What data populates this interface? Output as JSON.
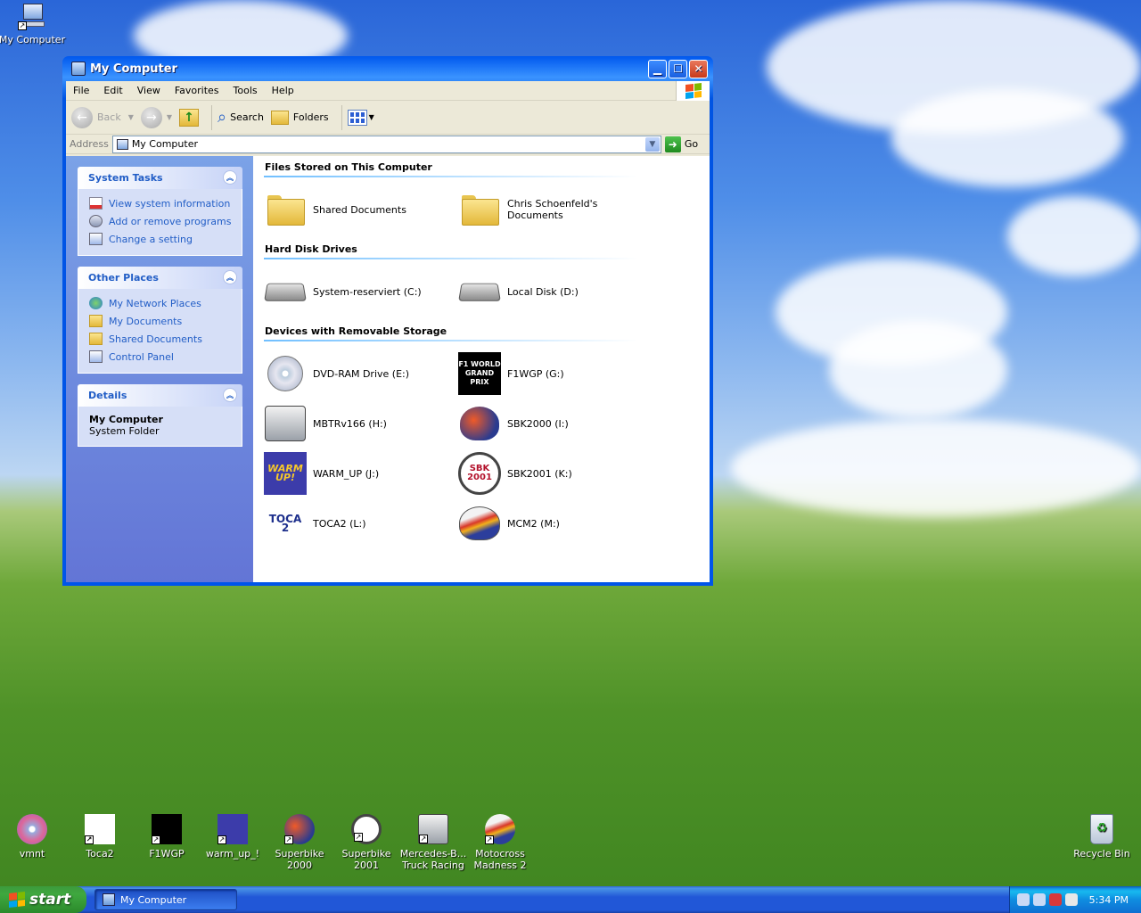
{
  "desktop": {
    "top_icons": [
      {
        "label": "My Computer"
      }
    ],
    "bottom_icons": [
      {
        "label": "vmnt"
      },
      {
        "label": "Toca2"
      },
      {
        "label": "F1WGP"
      },
      {
        "label": "warm_up_!"
      },
      {
        "label": "Superbike 2000"
      },
      {
        "label": "Superbike 2001"
      },
      {
        "label": "Mercedes-B... Truck Racing"
      },
      {
        "label": "Motocross Madness 2"
      }
    ],
    "recycle_bin": {
      "label": "Recycle Bin"
    }
  },
  "window": {
    "title": "My Computer",
    "menu": [
      "File",
      "Edit",
      "View",
      "Favorites",
      "Tools",
      "Help"
    ],
    "toolbar": {
      "back": "Back",
      "search": "Search",
      "folders": "Folders"
    },
    "address": {
      "label": "Address",
      "value": "My Computer",
      "go": "Go"
    },
    "tasks": {
      "system_tasks": {
        "title": "System Tasks",
        "links": [
          "View system information",
          "Add or remove programs",
          "Change a setting"
        ]
      },
      "other_places": {
        "title": "Other Places",
        "links": [
          "My Network Places",
          "My Documents",
          "Shared Documents",
          "Control Panel"
        ]
      },
      "details": {
        "title": "Details",
        "name": "My Computer",
        "type": "System Folder"
      }
    },
    "groups": {
      "files": {
        "title": "Files Stored on This Computer",
        "items": [
          "Shared Documents",
          "Chris Schoenfeld's Documents"
        ]
      },
      "hdd": {
        "title": "Hard Disk Drives",
        "items": [
          "System-reserviert (C:)",
          "Local Disk (D:)"
        ]
      },
      "removable": {
        "title": "Devices with Removable Storage",
        "items": [
          "DVD-RAM Drive (E:)",
          "F1WGP (G:)",
          "MBTRv166 (H:)",
          "SBK2000 (I:)",
          "WARM_UP (J:)",
          "SBK2001 (K:)",
          "TOCA2 (L:)",
          "MCM2 (M:)"
        ]
      }
    }
  },
  "taskbar": {
    "start": "start",
    "task_button": "My Computer",
    "clock": "5:34 PM"
  },
  "icon_logos": {
    "f1": "F1 WORLD GRAND PRIX",
    "warm": "WARM UP!",
    "sbk": "SBK 2001",
    "toca": "TOCA 2"
  }
}
